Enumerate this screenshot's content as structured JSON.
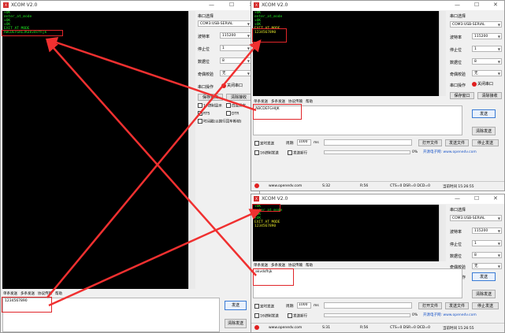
{
  "app_title": "XCOM V2.0",
  "window_controls": {
    "minimize": "—",
    "maximize": "☐",
    "close": "✕"
  },
  "serial": {
    "port_label": "串口选择",
    "port_value": "COM3:USB-SERIAL",
    "baud_label": "波特率",
    "baud_value": "115200",
    "stop_label": "停止位",
    "stop_value": "1",
    "data_label": "数据位",
    "data_value": "8",
    "parity_label": "奇偶校验",
    "parity_value": "无",
    "op_label": "串口操作",
    "close_button": "关闭串口"
  },
  "main_window": {
    "terminal_lines": [
      "+OK",
      "enter_at_mode",
      "+OK",
      "+OK",
      "EXIT AT MODE",
      "ABCDEFGHIJKakvdsfhjk"
    ],
    "save_window": "保存窗口",
    "clear_receive": "清除接收",
    "hex_display": "16进制显示",
    "white_bg": "白底黑字",
    "rts": "RTS",
    "dtr": "DTR",
    "timestamp": "时间戳(以换行回车断帧)",
    "tabs": [
      "单条发送",
      "多条发送",
      "协议传输",
      "帮助"
    ],
    "send_text": "1234567890",
    "send_button": "发送",
    "clear_send": "清除发送"
  },
  "top_right_window": {
    "terminal_lines": [
      "+OK",
      "enter_at_mode",
      "+OK",
      "+OK",
      "EXIT AT MODE",
      "1234567890"
    ],
    "save_window": "保存窗口",
    "clear_receive": "清除接收",
    "tabs": [
      "单条发送",
      "多条发送",
      "协议传输",
      "帮助"
    ],
    "send_text": "ABCDEFGHIJK",
    "send_button": "发送",
    "clear_send": "清除发送",
    "timed_send": "定时发送",
    "period_label": "周期:",
    "period_value": "1000",
    "ms": "ms",
    "hex_send": "16进制发送",
    "newline_send": "发送新行",
    "open_file": "打开文件",
    "send_file": "发送文件",
    "stop_send": "停止发送",
    "percent": "0%",
    "link": "开源电子网: www.openedv.com",
    "status": {
      "site": "www.openedv.com",
      "s": "S:32",
      "r": "R:56",
      "lines": "CTS=0 DSR=0 DCD=0",
      "time": "当前时间 15:26:55"
    }
  },
  "bottom_right_window": {
    "terminal_lines": [
      "+OK",
      "enter_at_mode",
      "+OK",
      "+OK",
      "EXIT AT MODE",
      "1234567890"
    ],
    "tabs": [
      "单条发送",
      "多条发送",
      "协议传输",
      "帮助"
    ],
    "send_text": "akvdsfhjk",
    "send_button": "发送",
    "clear_send": "清除发送",
    "timed_send": "定时发送",
    "period_label": "周期:",
    "period_value": "1000",
    "ms": "ms",
    "hex_send": "16进制发送",
    "newline_send": "发送新行",
    "open_file": "打开文件",
    "send_file": "发送文件",
    "stop_send": "停止发送",
    "percent": "0%",
    "link": "开源电子网: www.openedv.com",
    "status": {
      "site": "www.openedv.com",
      "s": "S:31",
      "r": "R:56",
      "lines": "CTS=0 DSR=0 DCD=0",
      "time": "当前时间 15:26:55"
    }
  },
  "colors": {
    "terminal_bg": "#000000",
    "terminal_text": "#22e622",
    "highlight_box": "#e0262a",
    "arrow": "#f03030"
  }
}
